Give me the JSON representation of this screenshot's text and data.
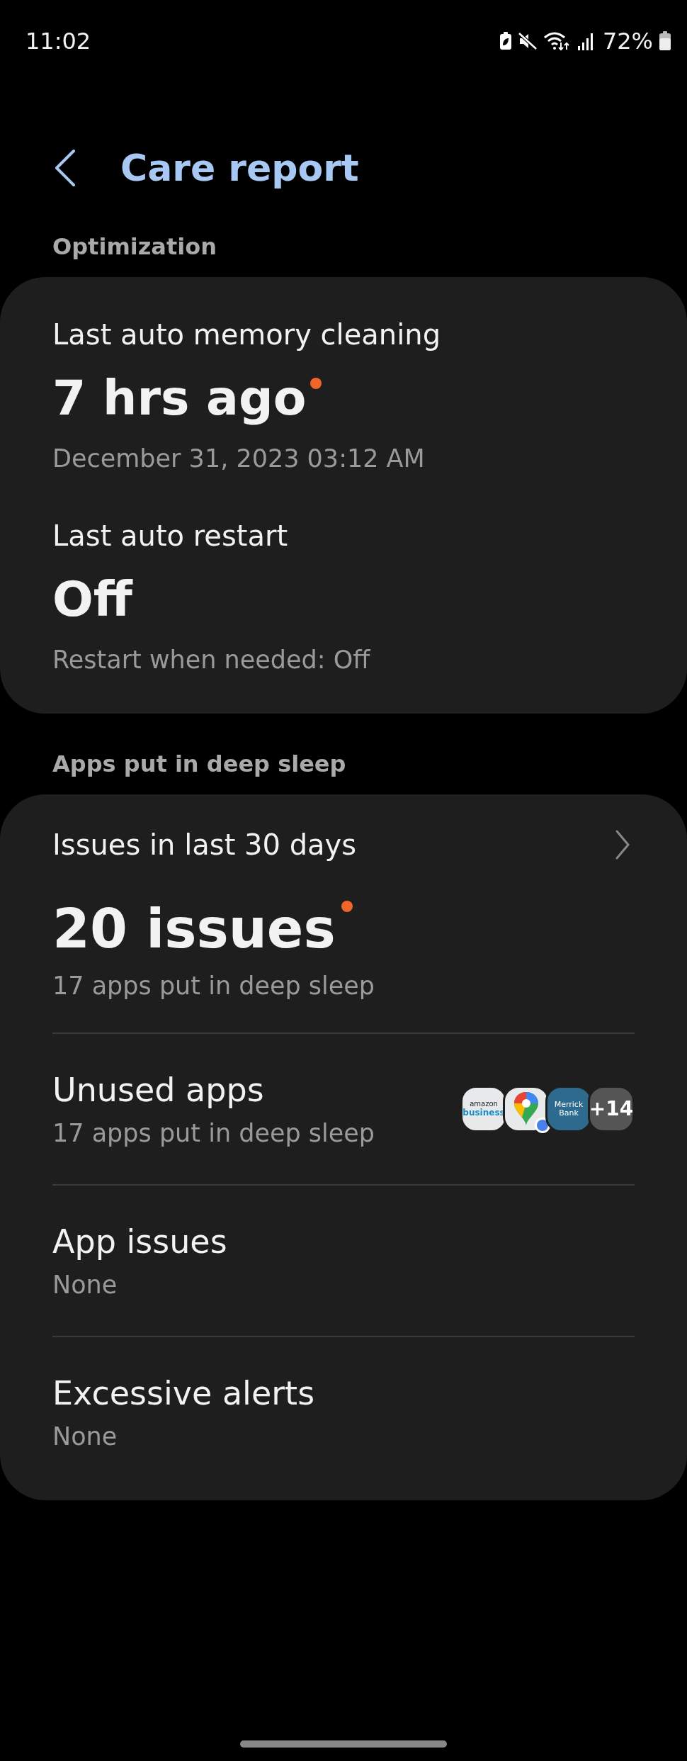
{
  "status_bar": {
    "time": "11:02",
    "battery": "72%"
  },
  "header": {
    "title": "Care report"
  },
  "optimization": {
    "heading": "Optimization",
    "items": [
      {
        "label": "Last auto memory cleaning",
        "value": "7 hrs ago",
        "new_dot": true,
        "detail": "December 31, 2023 03:12 AM"
      },
      {
        "label": "Last auto restart",
        "value": "Off",
        "new_dot": false,
        "detail": "Restart when needed: Off"
      }
    ]
  },
  "deep_sleep": {
    "heading": "Apps put in deep sleep",
    "summary": {
      "label": "Issues in last 30 days",
      "value": "20 issues",
      "new_dot": true,
      "detail": "17 apps put in deep sleep"
    },
    "rows": [
      {
        "title": "Unused apps",
        "subtitle": "17 apps put in deep sleep",
        "app_icons": [
          {
            "kind": "amazon",
            "lines": [
              "amazon",
              "business"
            ]
          },
          {
            "kind": "maps"
          },
          {
            "kind": "bank",
            "lines": [
              "Merrick",
              "Bank"
            ]
          }
        ],
        "more": "+14"
      },
      {
        "title": "App issues",
        "subtitle": "None"
      },
      {
        "title": "Excessive alerts",
        "subtitle": "None"
      }
    ]
  }
}
